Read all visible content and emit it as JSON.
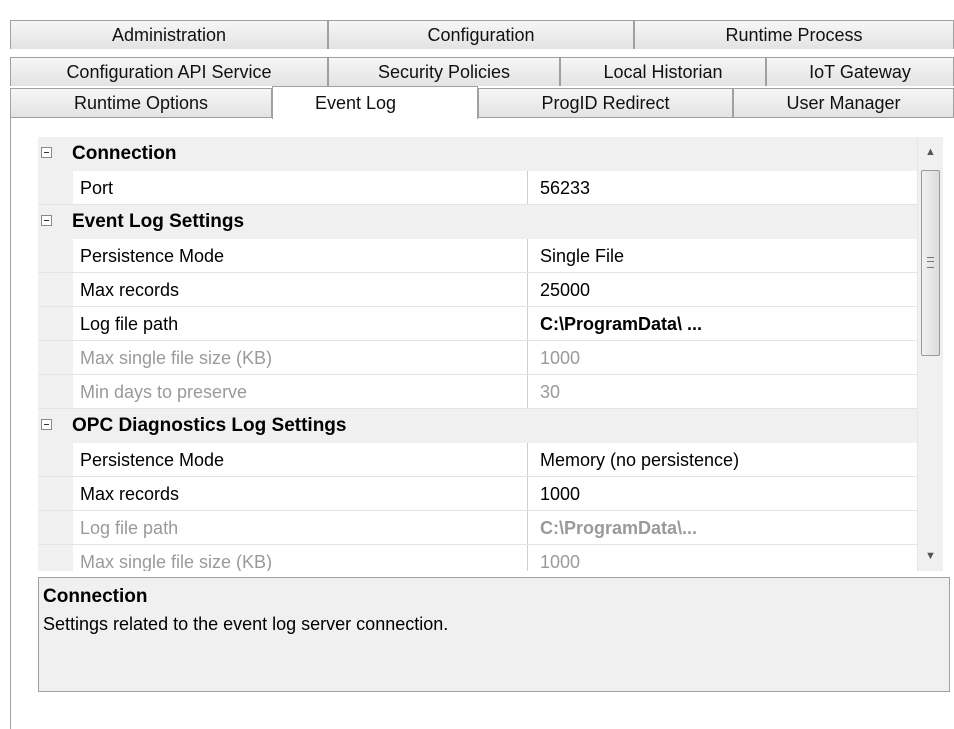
{
  "tabs": {
    "row1": [
      "Administration",
      "Configuration",
      "Runtime Process"
    ],
    "row2": [
      "Configuration API Service",
      "Security Policies",
      "Local Historian",
      "IoT Gateway"
    ],
    "row3": [
      "Runtime Options",
      "Event Log",
      "ProgID Redirect",
      "User Manager"
    ],
    "selected": "Event Log"
  },
  "grid": {
    "categories": [
      {
        "label": "Connection",
        "expanded": true,
        "properties": [
          {
            "name": "Port",
            "value": "56233",
            "enabled": true,
            "bold": false
          }
        ]
      },
      {
        "label": "Event Log Settings",
        "expanded": true,
        "properties": [
          {
            "name": "Persistence Mode",
            "value": "Single File",
            "enabled": true,
            "bold": false
          },
          {
            "name": "Max records",
            "value": "25000",
            "enabled": true,
            "bold": false
          },
          {
            "name": "Log file path",
            "value": "C:\\ProgramData\\ ...",
            "enabled": true,
            "bold": true
          },
          {
            "name": "Max single file size (KB)",
            "value": "1000",
            "enabled": false,
            "bold": false
          },
          {
            "name": "Min days to preserve",
            "value": "30",
            "enabled": false,
            "bold": false
          }
        ]
      },
      {
        "label": "OPC Diagnostics Log Settings",
        "expanded": true,
        "properties": [
          {
            "name": "Persistence Mode",
            "value": "Memory (no persistence)",
            "enabled": true,
            "bold": false
          },
          {
            "name": "Max records",
            "value": "1000",
            "enabled": true,
            "bold": false
          },
          {
            "name": "Log file path",
            "value": "C:\\ProgramData\\...",
            "enabled": false,
            "bold": true
          },
          {
            "name": "Max single file size (KB)",
            "value": "1000",
            "enabled": false,
            "bold": false
          }
        ]
      }
    ]
  },
  "help": {
    "title": "Connection",
    "description": "Settings related to the event log server connection."
  },
  "icons": {
    "collapse": "minus-box-icon",
    "scroll_up": "arrow-up-icon",
    "scroll_down": "arrow-down-icon",
    "thumb_grip": "grip-icon"
  }
}
